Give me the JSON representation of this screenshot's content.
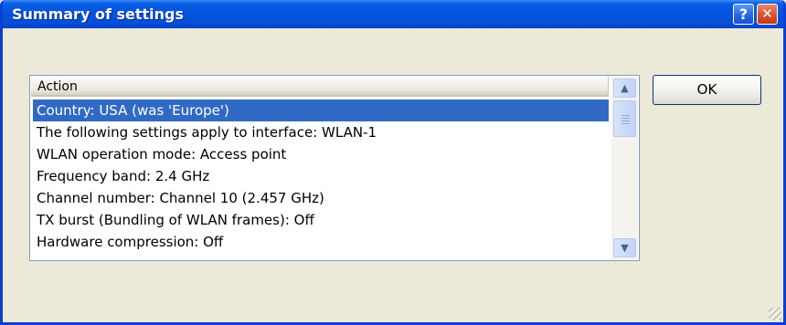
{
  "window": {
    "title": "Summary of settings",
    "help_label": "?",
    "close_label": "✕"
  },
  "list": {
    "column_header": "Action",
    "rows": [
      "Country: USA (was 'Europe')",
      "The following settings apply to interface: WLAN-1",
      "WLAN operation mode: Access point",
      "Frequency band: 2.4 GHz",
      "Channel number: Channel 10 (2.457 GHz)",
      "TX burst (Bundling of WLAN frames): Off",
      "Hardware compression: Off"
    ],
    "selected_row": 0,
    "scroll_up_glyph": "▲",
    "scroll_down_glyph": "▼"
  },
  "buttons": {
    "ok_label": "OK"
  },
  "colors": {
    "titlebar": "#0453dd",
    "selection": "#316ac5",
    "dialog_bg": "#ece9d8"
  },
  "icons": [
    "help-icon",
    "close-icon",
    "scroll-up-icon",
    "scroll-down-icon",
    "resize-grip-icon"
  ]
}
